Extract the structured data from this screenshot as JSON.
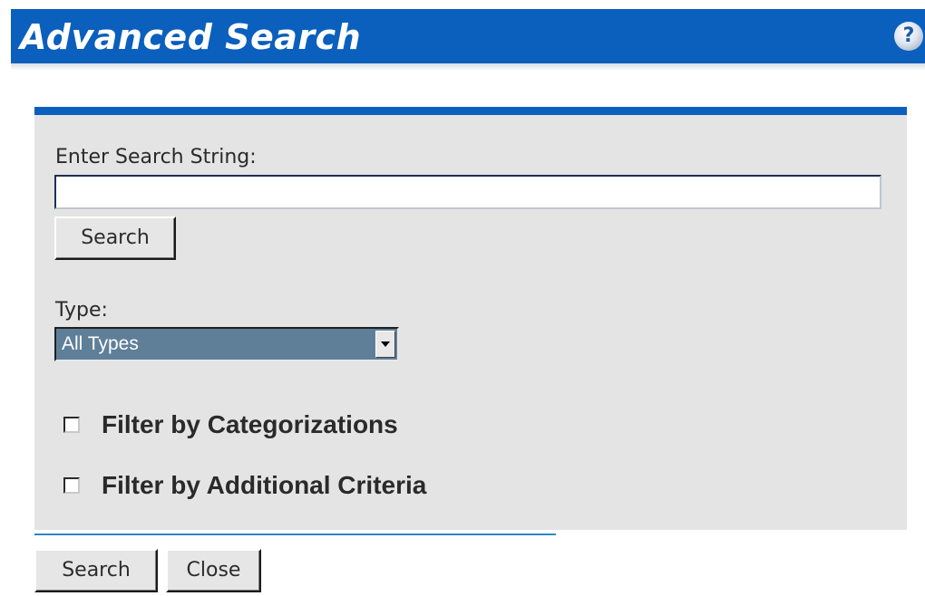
{
  "header": {
    "title": "Advanced Search",
    "help_icon_glyph": "?",
    "help_icon": "help-icon",
    "color": "#0b5fbd"
  },
  "form": {
    "search_label": "Enter Search String:",
    "search_value": "",
    "search_button_label": "Search",
    "type_label": "Type:",
    "type_selected": "All Types",
    "checkboxes": [
      {
        "label": "Filter by Categorizations",
        "checked": false
      },
      {
        "label": "Filter by Additional Criteria",
        "checked": false
      }
    ]
  },
  "footer": {
    "search_button_label": "Search",
    "close_button_label": "Close"
  }
}
